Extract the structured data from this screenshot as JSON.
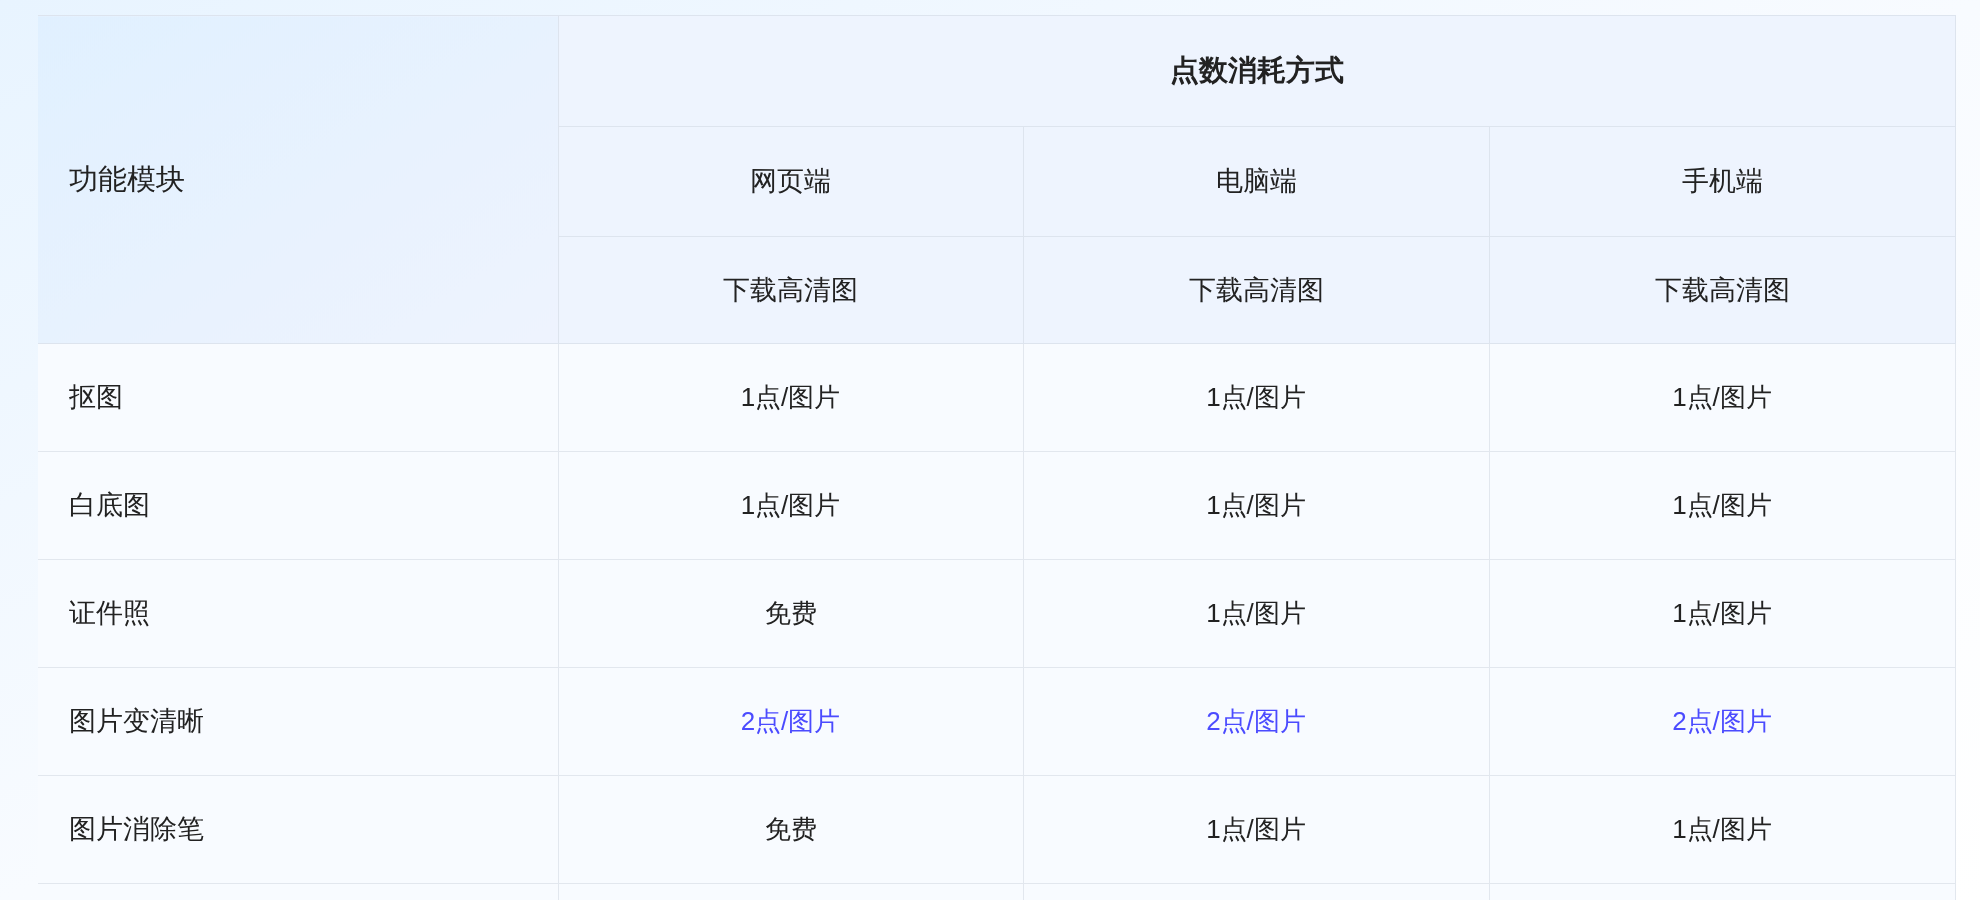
{
  "table": {
    "corner_header": "功能模块",
    "group_header": "点数消耗方式",
    "platforms": [
      "网页端",
      "电脑端",
      "手机端"
    ],
    "actions": [
      "下载高清图",
      "下载高清图",
      "下载高清图"
    ],
    "rows": [
      {
        "module": "抠图",
        "values": [
          "1点/图片",
          "1点/图片",
          "1点/图片"
        ],
        "highlighted": false
      },
      {
        "module": "白底图",
        "values": [
          "1点/图片",
          "1点/图片",
          "1点/图片"
        ],
        "highlighted": false
      },
      {
        "module": "证件照",
        "values": [
          "免费",
          "1点/图片",
          "1点/图片"
        ],
        "highlighted": false
      },
      {
        "module": "图片变清晰",
        "values": [
          "2点/图片",
          "2点/图片",
          "2点/图片"
        ],
        "highlighted": true
      },
      {
        "module": "图片消除笔",
        "values": [
          "免费",
          "1点/图片",
          "1点/图片"
        ],
        "highlighted": false
      }
    ]
  }
}
